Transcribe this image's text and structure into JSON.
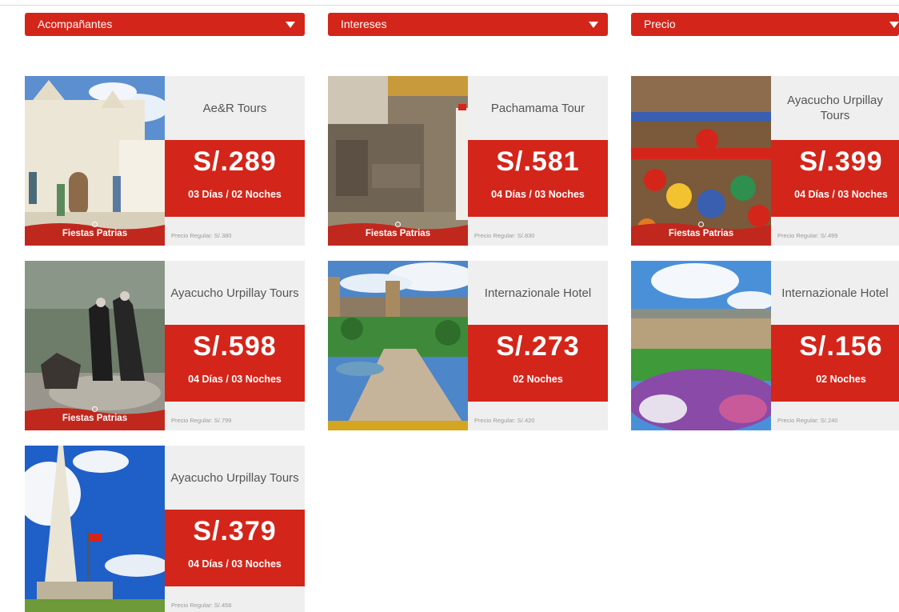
{
  "filters": [
    {
      "label": "Acompañantes"
    },
    {
      "label": "Intereses"
    },
    {
      "label": "Precio"
    }
  ],
  "ribbon_label": "Fiestas Patrias",
  "cards": [
    {
      "name": "Ae&R Tours",
      "price": "S/.289",
      "duration": "03 Días / 02 Noches",
      "regular": "Precio Regular: S/.380"
    },
    {
      "name": "Pachamama Tour",
      "price": "S/.581",
      "duration": "04 Días / 03 Noches",
      "regular": "Precio Regular: S/.830"
    },
    {
      "name": "Ayacucho Urpillay Tours",
      "price": "S/.399",
      "duration": "04 Días / 03 Noches",
      "regular": "Precio Regular: S/.499"
    },
    {
      "name": "Ayacucho Urpillay Tours",
      "price": "S/.598",
      "duration": "04 Días / 03 Noches",
      "regular": "Precio Regular: S/.799"
    },
    {
      "name": "Internazionale Hotel",
      "price": "S/.273",
      "duration": "02 Noches",
      "regular": "Precio Regular: S/.420"
    },
    {
      "name": "Internazionale Hotel",
      "price": "S/.156",
      "duration": "02 Noches",
      "regular": "Precio Regular: S/.240"
    },
    {
      "name": "Ayacucho Urpillay Tours",
      "price": "S/.379",
      "duration": "04 Días / 03 Noches",
      "regular": "Precio Regular: S/.458"
    }
  ],
  "colors": {
    "accent": "#d4251a",
    "panel": "#efefef",
    "text": "#555555",
    "muted": "#9a9a9a"
  }
}
